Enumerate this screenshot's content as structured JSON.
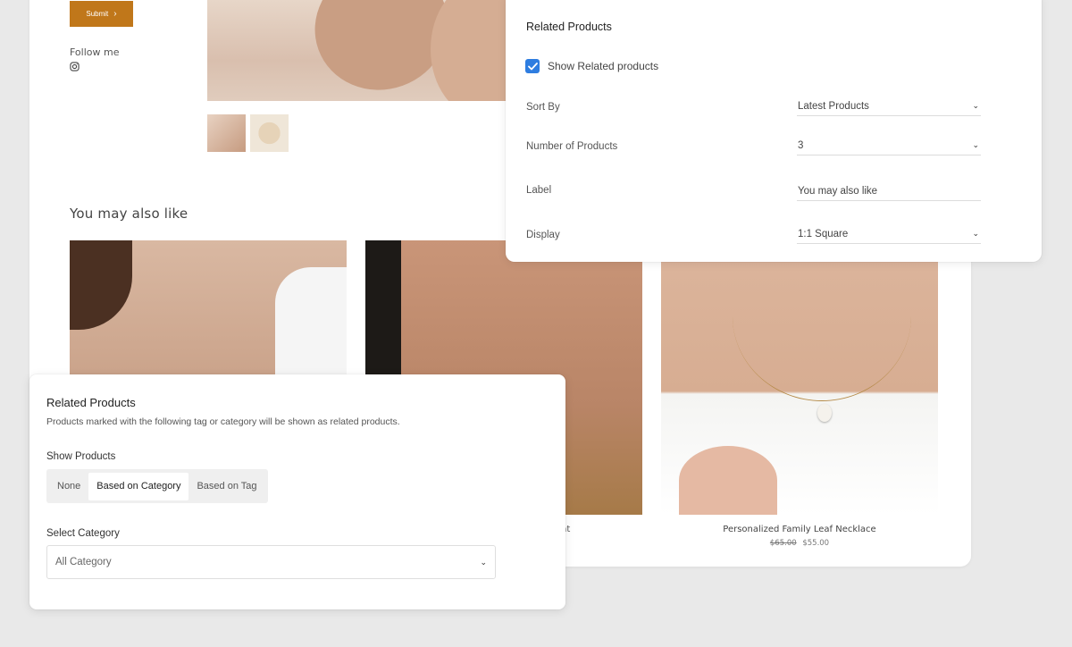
{
  "storefront": {
    "submit_label": "Submit",
    "follow_label": "Follow me",
    "section_heading": "You may also like",
    "product_2_name_fragment": "nt",
    "product_3": {
      "name": "Personalized Family Leaf Necklace",
      "old_price": "$65.00",
      "price": "$55.00"
    }
  },
  "related_settings": {
    "title": "Related Products",
    "show_related_label": "Show Related products",
    "show_related_checked": true,
    "sort_by_label": "Sort By",
    "sort_by_value": "Latest Products",
    "count_label": "Number of Products",
    "count_value": "3",
    "label_label": "Label",
    "label_value": "You may also like",
    "display_label": "Display",
    "display_value": "1:1 Square"
  },
  "related_rules": {
    "title": "Related Products",
    "description": "Products marked with the following tag or category will be shown as related products.",
    "show_products_label": "Show Products",
    "options": [
      "None",
      "Based on Category",
      "Based on Tag"
    ],
    "selected_option": "Based on Category",
    "select_category_label": "Select Category",
    "select_category_value": "All Category"
  },
  "colors": {
    "accent_button": "#c0771a",
    "checkbox": "#2e7de0"
  },
  "icons": {
    "social": "instagram-icon",
    "dropdown": "chevron-down-icon",
    "button_arrow": "chevron-right-icon"
  }
}
